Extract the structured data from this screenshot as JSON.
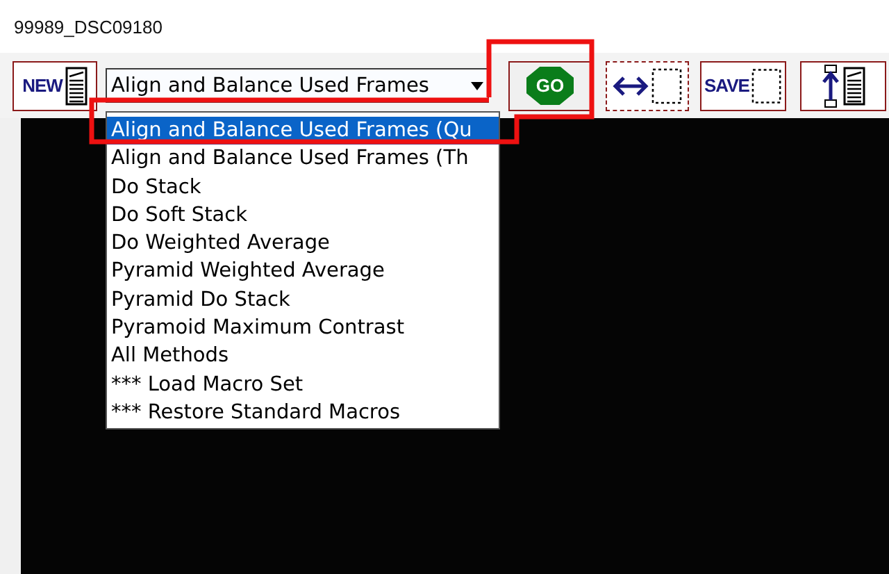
{
  "window": {
    "title": "99989_DSC09180"
  },
  "toolbar": {
    "new_button": "NEW",
    "method_select": {
      "value": "Align and Balance Used Frames",
      "expanded": true
    },
    "go_button": "GO",
    "save_button": "SAVE"
  },
  "dropdown": {
    "items": [
      {
        "label": "Align and Balance Used Frames (Qu",
        "selected": true
      },
      {
        "label": "Align and Balance Used Frames (Th",
        "selected": false
      },
      {
        "label": "Do Stack",
        "selected": false
      },
      {
        "label": "Do Soft Stack",
        "selected": false
      },
      {
        "label": "Do Weighted Average",
        "selected": false
      },
      {
        "label": "Pyramid Weighted Average",
        "selected": false
      },
      {
        "label": "Pyramid Do Stack",
        "selected": false
      },
      {
        "label": "Pyramoid Maximum Contrast",
        "selected": false
      },
      {
        "label": "All Methods",
        "selected": false
      },
      {
        "label": "*** Load Macro Set",
        "selected": false
      },
      {
        "label": "*** Restore Standard Macros",
        "selected": false
      }
    ]
  }
}
